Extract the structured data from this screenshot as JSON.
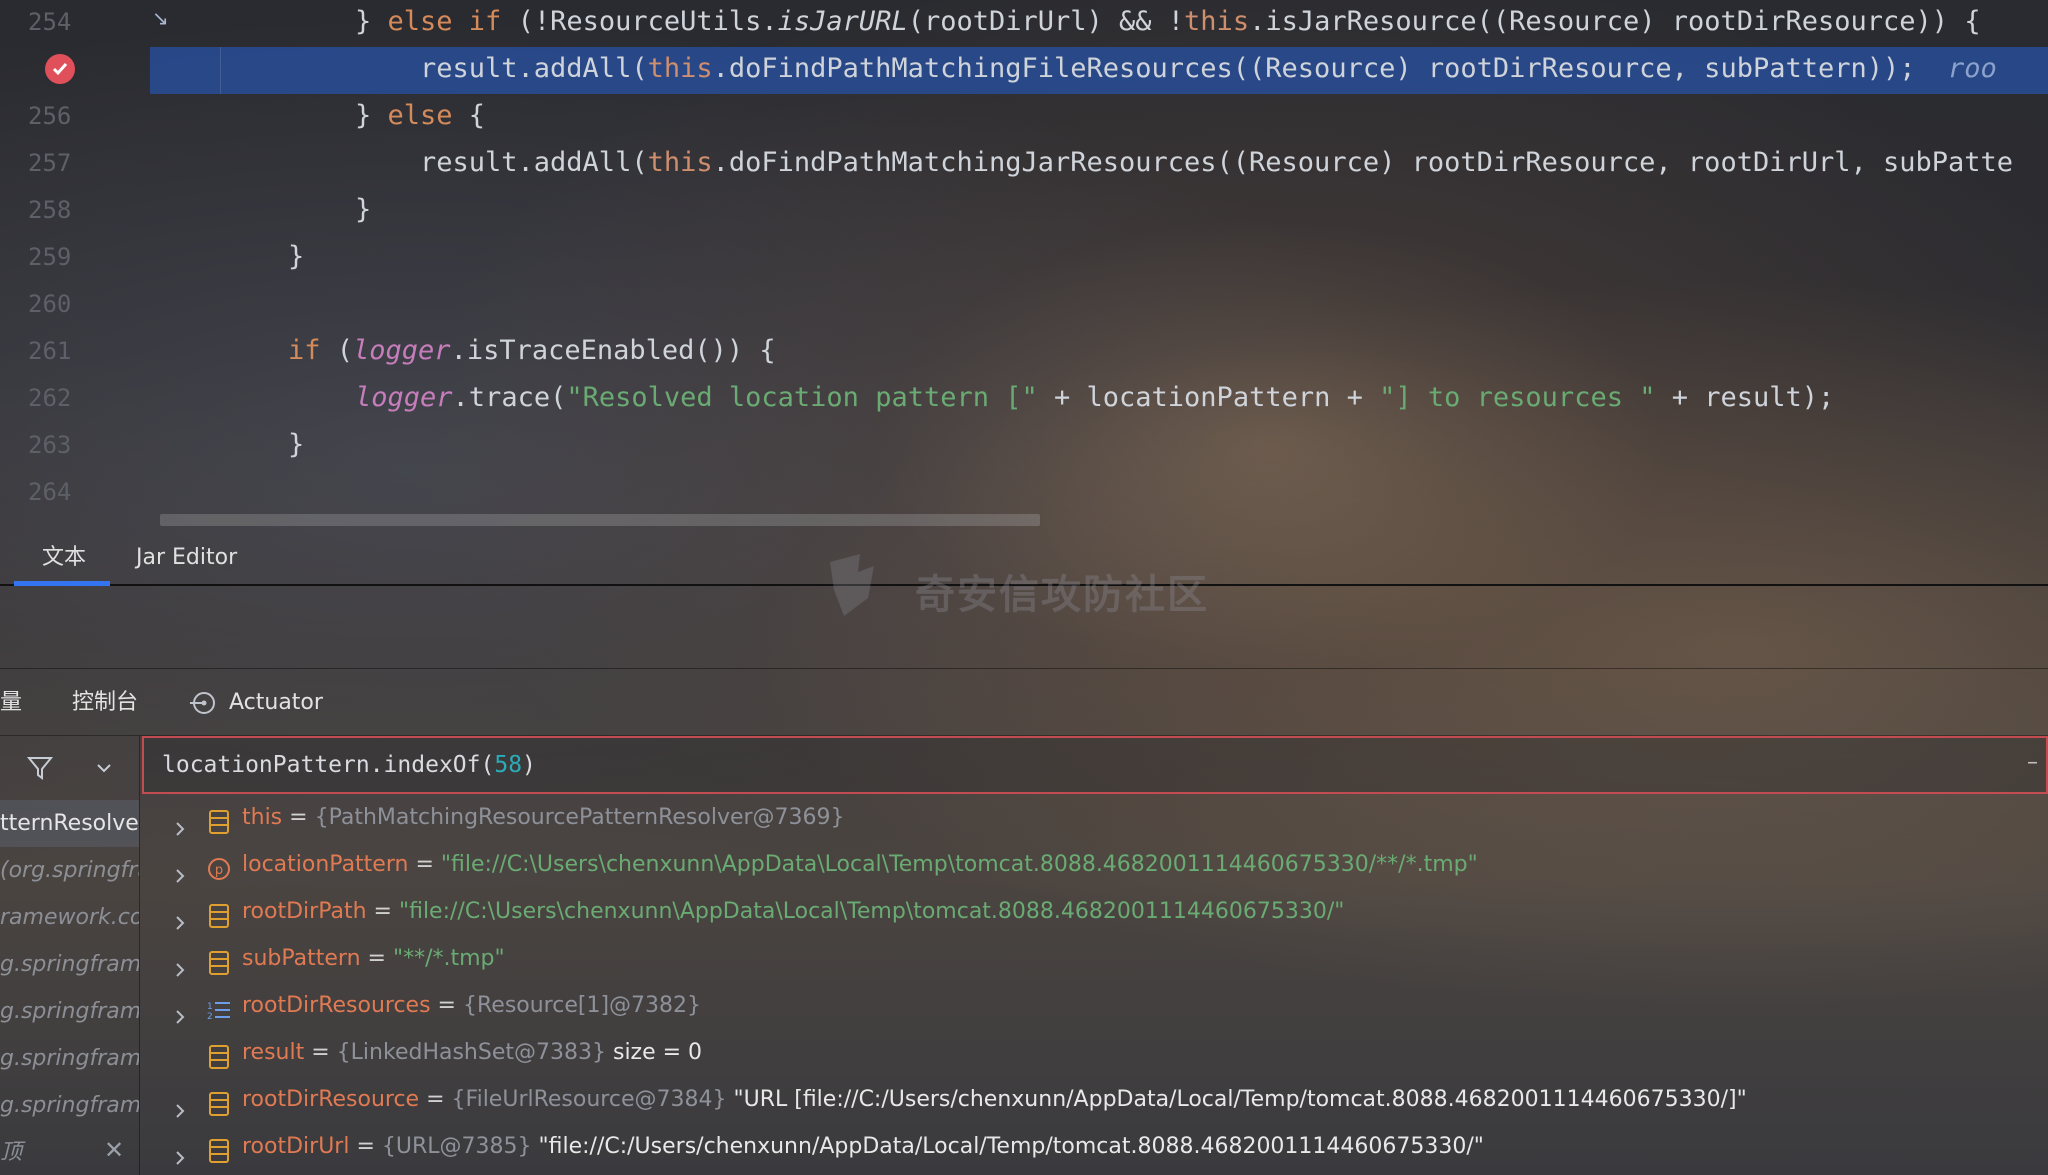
{
  "editor": {
    "line_numbers": [
      "254",
      "",
      "256",
      "257",
      "258",
      "259",
      "260",
      "261",
      "262",
      "263",
      "264"
    ],
    "lines": [
      {
        "parts": [
          [
            "",
            "} "
          ],
          [
            "kw",
            "else if"
          ],
          [
            "",
            " (!ResourceUtils."
          ],
          [
            "it",
            "isJarURL"
          ],
          [
            "",
            "(rootDirUrl) && !"
          ],
          [
            "this",
            "this"
          ],
          [
            "",
            ".isJarResource((Resource) rootDirResource)) {"
          ]
        ]
      },
      {
        "parts": [
          [
            "",
            "result.addAll("
          ],
          [
            "this",
            "this"
          ],
          [
            "",
            ".doFindPathMatchingFileResources((Resource) rootDirResource, subPattern));  "
          ],
          [
            "hint",
            "roo"
          ]
        ]
      },
      {
        "parts": [
          [
            "",
            "} "
          ],
          [
            "kw",
            "else"
          ],
          [
            "",
            " {"
          ]
        ]
      },
      {
        "parts": [
          [
            "",
            "result.addAll("
          ],
          [
            "this",
            "this"
          ],
          [
            "",
            ".doFindPathMatchingJarResources((Resource) rootDirResource, rootDirUrl, subPatte"
          ]
        ]
      },
      {
        "parts": [
          [
            "",
            "}"
          ]
        ]
      },
      {
        "parts": [
          [
            "",
            "}"
          ]
        ]
      },
      {
        "parts": [
          [
            "",
            ""
          ]
        ]
      },
      {
        "parts": [
          [
            "kw",
            "if"
          ],
          [
            "",
            " ("
          ],
          [
            "field",
            "logger"
          ],
          [
            "",
            ".isTraceEnabled()) {"
          ]
        ]
      },
      {
        "parts": [
          [
            "field",
            "logger"
          ],
          [
            "",
            ".trace("
          ],
          [
            "str",
            "\"Resolved location pattern [\""
          ],
          [
            "",
            " + locationPattern + "
          ],
          [
            "str",
            "\"] to resources \""
          ],
          [
            "",
            " + result);"
          ]
        ]
      },
      {
        "parts": [
          [
            "",
            "}"
          ]
        ]
      },
      {
        "parts": [
          [
            "",
            ""
          ]
        ]
      }
    ]
  },
  "editor_tabs": [
    "文本",
    "Jar Editor"
  ],
  "watermark": "奇安信攻防社区",
  "debug_tabs": {
    "vars_partial": "量",
    "console": "控制台",
    "actuator": "Actuator"
  },
  "frames": [
    "tternResolver",
    "(org.springfra",
    "ramework.cor",
    "g.springframe",
    "g.springframe",
    "g.springframe",
    "g.springframe",
    "顶"
  ],
  "expression": {
    "prefix": "locationPattern.indexOf(",
    "number": "58",
    "suffix": ")"
  },
  "variables": [
    {
      "expand": true,
      "icon": "field",
      "name": "this",
      "type": "{PathMatchingResourcePatternResolver@7369}",
      "str": "",
      "text": ""
    },
    {
      "expand": true,
      "icon": "param",
      "name": "locationPattern",
      "type": "",
      "str": "\"file://C:\\Users\\chenxunn\\AppData\\Local\\Temp\\tomcat.8088.4682001114460675330/**/*.tmp\"",
      "text": ""
    },
    {
      "expand": true,
      "icon": "field",
      "name": "rootDirPath",
      "type": "",
      "str": "\"file://C:\\Users\\chenxunn\\AppData\\Local\\Temp\\tomcat.8088.4682001114460675330/\"",
      "text": ""
    },
    {
      "expand": true,
      "icon": "field",
      "name": "subPattern",
      "type": "",
      "str": "\"**/*.tmp\"",
      "text": ""
    },
    {
      "expand": true,
      "icon": "array",
      "name": "rootDirResources",
      "type": "{Resource[1]@7382}",
      "str": "",
      "text": ""
    },
    {
      "expand": false,
      "icon": "field",
      "name": "result",
      "type": "{LinkedHashSet@7383}",
      "str": "",
      "text": "size = 0"
    },
    {
      "expand": true,
      "icon": "field",
      "name": "rootDirResource",
      "type": "{FileUrlResource@7384}",
      "str": "",
      "text": "\"URL [file://C:/Users/chenxunn/AppData/Local/Temp/tomcat.8088.4682001114460675330/]\""
    },
    {
      "expand": true,
      "icon": "field",
      "name": "rootDirUrl",
      "type": "{URL@7385}",
      "str": "",
      "text": "\"file://C:/Users/chenxunn/AppData/Local/Temp/tomcat.8088.4682001114460675330/\""
    }
  ],
  "colors": {
    "accent": "#3574f0",
    "breakpoint": "#e0505a",
    "highlight": "#28509f",
    "string": "#6aab73",
    "var_name": "#e07a52"
  }
}
